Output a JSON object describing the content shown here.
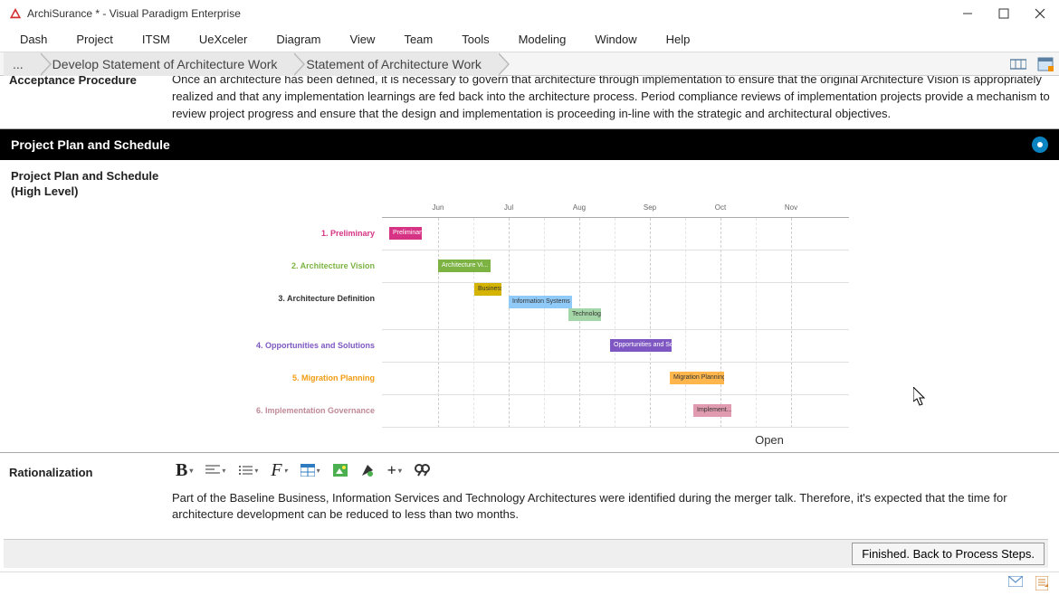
{
  "window": {
    "title": "ArchiSurance * - Visual Paradigm Enterprise"
  },
  "menu": [
    "Dash",
    "Project",
    "ITSM",
    "UeXceler",
    "Diagram",
    "View",
    "Team",
    "Tools",
    "Modeling",
    "Window",
    "Help"
  ],
  "breadcrumb": {
    "ellipsis": "...",
    "items": [
      "Develop Statement of Architecture Work",
      "Statement of Architecture Work"
    ]
  },
  "accept_section": {
    "label": "Acceptance Procedure",
    "text": "Once an architecture has been defined, it is necessary to govern that architecture through implementation to ensure that the original Architecture Vision is appropriately realized and that any implementation learnings are fed back into the architecture process. Period compliance reviews of implementation projects provide a mechanism to review project progress and ensure that the design and implementation is proceeding in-line with the strategic and architectural objectives."
  },
  "black_header": "Project Plan and Schedule",
  "plan": {
    "title1": "Project Plan and Schedule",
    "title2": "(High Level)",
    "months": [
      "Jun",
      "Jul",
      "Aug",
      "Sep",
      "Oct",
      "Nov"
    ],
    "rows": [
      {
        "label": "1. Preliminary",
        "labelClass": "lbl-prelim",
        "tasks": [
          {
            "name": "Preliminary",
            "class": "t-prelim",
            "start": 8,
            "width": 36
          }
        ]
      },
      {
        "label": "2. Architecture Vision",
        "labelClass": "lbl-vision",
        "tasks": [
          {
            "name": "Architecture Vi...",
            "class": "t-vision",
            "start": 62,
            "width": 58
          }
        ]
      },
      {
        "label": "3. Architecture Definition",
        "labelClass": "lbl-arch",
        "tasks": [
          {
            "name": "Business",
            "class": "t-biz",
            "start": 102,
            "width": 30,
            "offsetY": -10
          },
          {
            "name": "Information Systems",
            "class": "t-info",
            "start": 140,
            "width": 70,
            "offsetY": 4
          },
          {
            "name": "Technology",
            "class": "t-tech",
            "start": 206,
            "width": 36,
            "offsetY": 18
          }
        ]
      },
      {
        "label": "4. Opportunities and Solutions",
        "labelClass": "lbl-opp",
        "tasks": [
          {
            "name": "Opportunities and So...",
            "class": "t-opp",
            "start": 252,
            "width": 68
          }
        ]
      },
      {
        "label": "5. Migration Planning",
        "labelClass": "lbl-mig",
        "tasks": [
          {
            "name": "Migration Planning",
            "class": "t-mig",
            "start": 318,
            "width": 60
          }
        ]
      },
      {
        "label": "6. Implementation Governance",
        "labelClass": "lbl-impl",
        "tasks": [
          {
            "name": "Implement...",
            "class": "t-impl",
            "start": 344,
            "width": 42
          }
        ]
      }
    ],
    "open": "Open"
  },
  "ration": {
    "label": "Rationalization",
    "text": "Part of the Baseline Business, Information Services and Technology Architectures were identified during the merger talk. Therefore, it's expected that the time for architecture development can be reduced to less than two months."
  },
  "buttons": {
    "finish": "Finished. Back to Process Steps."
  },
  "chart_data": {
    "type": "bar",
    "title": "Project Plan and Schedule (High Level)",
    "categories": [
      "Jun",
      "Jul",
      "Aug",
      "Sep",
      "Oct",
      "Nov"
    ],
    "series": [
      {
        "name": "Preliminary",
        "start": "Jun",
        "duration_weeks": 2
      },
      {
        "name": "Architecture Vision",
        "start": "Jul",
        "duration_weeks": 3
      },
      {
        "name": "Business",
        "start": "mid-Jul",
        "duration_weeks": 2
      },
      {
        "name": "Information Systems",
        "start": "Aug",
        "duration_weeks": 4
      },
      {
        "name": "Technology",
        "start": "late-Aug",
        "duration_weeks": 2
      },
      {
        "name": "Opportunities and Solutions",
        "start": "Sep",
        "duration_weeks": 3
      },
      {
        "name": "Migration Planning",
        "start": "Oct",
        "duration_weeks": 3
      },
      {
        "name": "Implementation Governance",
        "start": "mid-Oct",
        "duration_weeks": 2
      }
    ]
  }
}
